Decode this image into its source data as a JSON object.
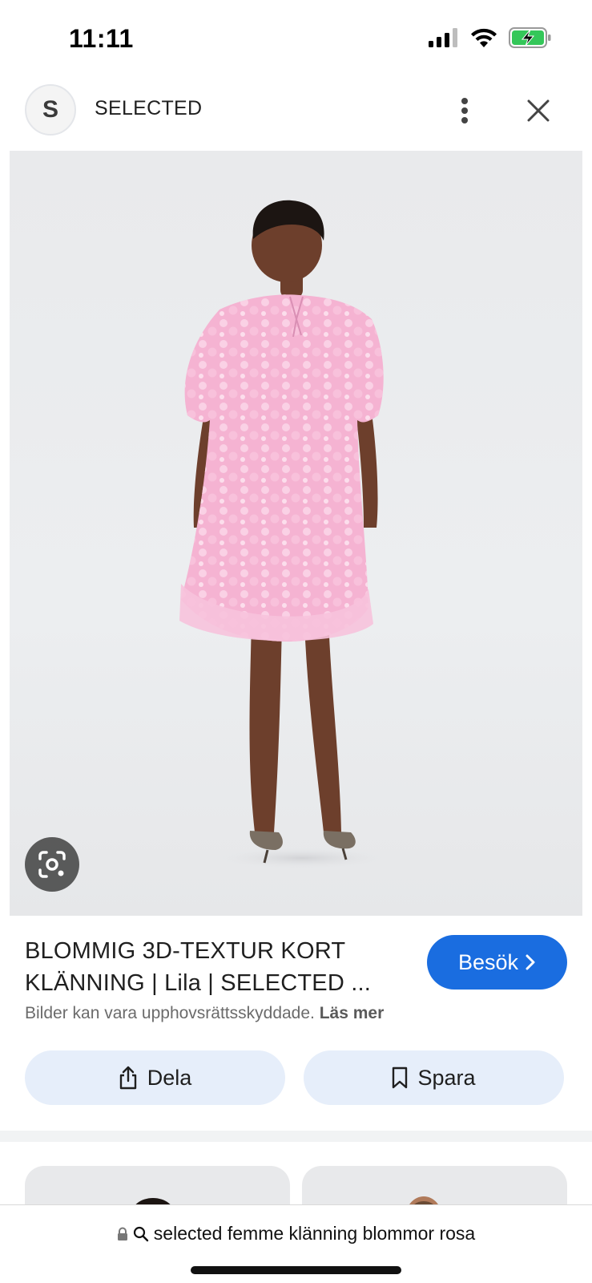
{
  "status_bar": {
    "time": "11:11",
    "icons": [
      "cellular-signal-icon",
      "wifi-icon",
      "battery-charging-icon"
    ]
  },
  "header": {
    "avatar_letter": "S",
    "site_name": "SELECTED",
    "more_icon": "more-vert-icon",
    "close_icon": "close-icon"
  },
  "image": {
    "lens_icon": "lens-icon"
  },
  "result": {
    "title_line1": "BLOMMIG 3D-TEXTUR KORT",
    "title_line2": "KLÄNNING | Lila | SELECTED ...",
    "visit_label": "Besök",
    "copyright_text": "Bilder kan vara upphovsrättsskyddade.",
    "learn_more": "Läs mer"
  },
  "actions": {
    "share_label": "Dela",
    "save_label": "Spara"
  },
  "url_bar": {
    "query": "selected femme klänning blommor rosa"
  },
  "colors": {
    "accent": "#1a6de0",
    "action_bg": "#e6eefa",
    "dress_pink": "#f5b3d2",
    "battery_green": "#34c759"
  }
}
